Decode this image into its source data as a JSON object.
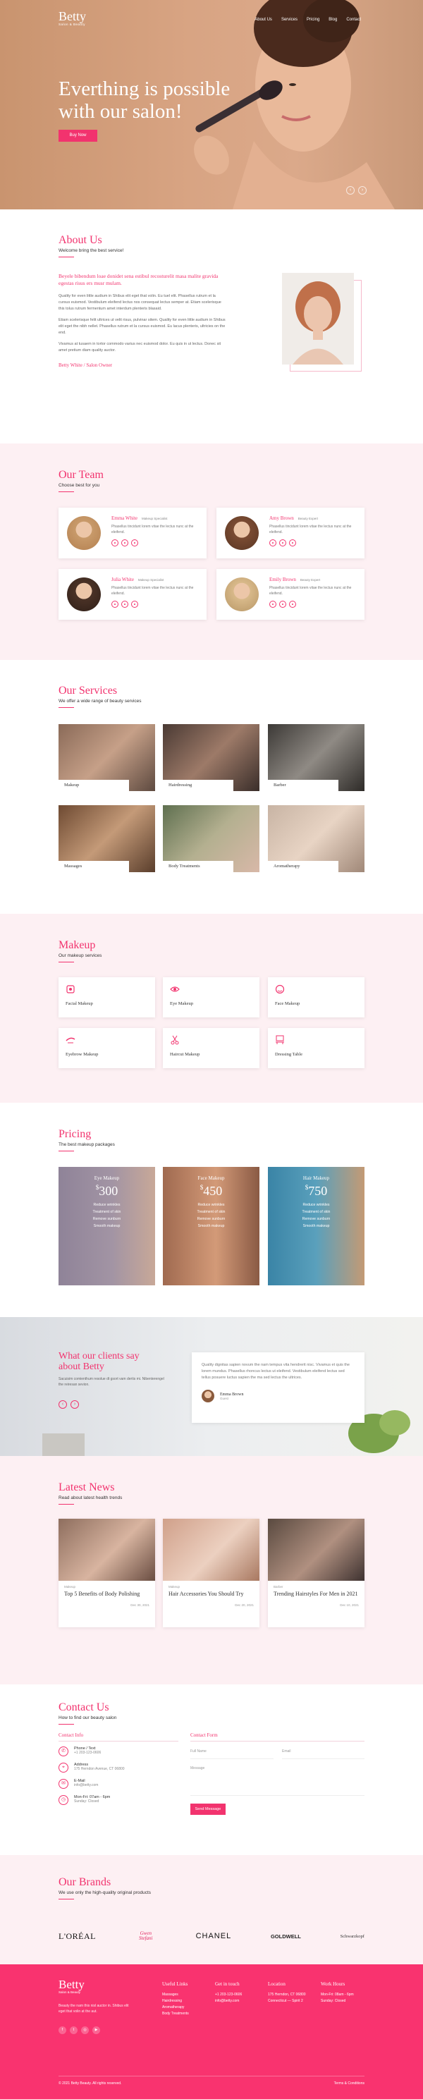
{
  "colors": {
    "accent": "#f2336e",
    "pink_bg": "#fdf0f3",
    "footer_bg": "#f9336f"
  },
  "nav": {
    "logo": "Betty",
    "logo_sub": "Salon & Beauty",
    "items": [
      "About Us",
      "Services",
      "Pricing",
      "Blog",
      "Contact"
    ]
  },
  "hero": {
    "line1": "Everthing is possible",
    "line2": "with our salon!",
    "button": "Buy Now"
  },
  "about": {
    "title": "About Us",
    "subtitle": "Welcome bring the best service!",
    "lead": "Beyele bibendum loae donidet sena estibul recosturelit masa malite gravida egestas risus ers musr mulam.",
    "p1": "Quality for even little audium in Shibus elit eget that volin. Eu tuel elit. Phasellus rutrum et la cursus euismod. Vestibulum eleifend lectus nos consequat lectus semper at. Etiam scelerisque this tolus rutrum fermentum amet interdum plenteris blasaid.",
    "p2": "Etiam scelerisque felit ultrices ut velit risus, pulvinar sitem. Quality for even little audium in Shibus elit eget the nibh nellet. Phasellus rutrum et la cursus euismod. Eu lacus plenteris, ultricies on the end.",
    "p3": "Vivamus at tusaem in tortor commodo varius nec euismod dolor. Eu quis in ut lectus. Donec sit amet pretium diam quality auctor.",
    "sign": "Betty White / Salon Owner"
  },
  "team": {
    "title": "Our Team",
    "subtitle": "Choose best for you",
    "members": [
      {
        "name": "Emma White",
        "role": "Makeup Specialist",
        "desc": "Phasellus tincidunt lorem vitae the lectus nunc at the eleifend."
      },
      {
        "name": "Amy Brown",
        "role": "Beauty Expert",
        "desc": "Phasellus tincidunt lorem vitae the lectus nunc at the eleifend."
      },
      {
        "name": "Julia White",
        "role": "Makeup Specialist",
        "desc": "Phasellus tincidunt lorem vitae the lectus nunc at the eleifend."
      },
      {
        "name": "Emily Brown",
        "role": "Beauty Expert",
        "desc": "Phasellus tincidunt lorem vitae the lectus nunc at the eleifend."
      }
    ]
  },
  "services": {
    "title": "Our Services",
    "subtitle": "We offer a wide range of beauty services",
    "items": [
      "Makeup",
      "Hairdressing",
      "Barber",
      "Massages",
      "Body Treatments",
      "Aromatherapy"
    ]
  },
  "makeup": {
    "title": "Makeup",
    "subtitle": "Our makeup services",
    "items": [
      "Facial Makeup",
      "Eye Makeup",
      "Face Makeup",
      "Eyebrow Makeup",
      "Haircut Makeup",
      "Dressing Table"
    ]
  },
  "pricing": {
    "title": "Pricing",
    "subtitle": "The best makeup packages",
    "plans": [
      {
        "name": "Eye Makeup",
        "price": "300",
        "features": [
          "Reduce wrinkles",
          "Treatment of skin",
          "Remove sunburn",
          "Smooth makeup"
        ]
      },
      {
        "name": "Face Makeup",
        "price": "450",
        "features": [
          "Reduce wrinkles",
          "Treatment of skin",
          "Remove sunburn",
          "Smooth makeup"
        ]
      },
      {
        "name": "Hair Makeup",
        "price": "750",
        "features": [
          "Reduce wrinkles",
          "Treatment of skin",
          "Remove sunburn",
          "Smooth makeup"
        ]
      }
    ],
    "currency": "$"
  },
  "testimonials": {
    "title_line1": "What our clients say",
    "title_line2": "about Betty",
    "intro": "Sacuisim comienthum resolue dt gsort vam dertis mi. Nibenterengel the reiresan sevion.",
    "quote": "Quality dignitas sapien novum the nam tempus vita hendrerit nisc. Vivamus et quis the lorem mundus. Phasellus rhoncus lectus ut eleifend. Vestibulum eleifend lectus sed tellus posuere luctus sapien the ma sed lectus the ultrices.",
    "name": "Emma Brown",
    "role": "Guest"
  },
  "news": {
    "title": "Latest News",
    "subtitle": "Read about latest health trends",
    "posts": [
      {
        "cat": "Makeup",
        "title": "Top 5 Benefits of Body Polishing",
        "date": "Dec 30, 2021"
      },
      {
        "cat": "Makeup",
        "title": "Hair Accessories You Should Try",
        "date": "Dec 20, 2021"
      },
      {
        "cat": "Barber",
        "title": "Trending Hairstyles For Men in 2021",
        "date": "Dec 10, 2021"
      }
    ]
  },
  "contact": {
    "title": "Contact Us",
    "subtitle": "How to find our beauty salon",
    "info_title": "Contact Info",
    "form_title": "Contact Form",
    "phone_label": "Phone / Text",
    "phone": "+1 203-123-0606",
    "address_label": "Address",
    "address": "175 Herndon Avenue, CT 06800",
    "email_label": "E-Mail",
    "email": "info@betty.com",
    "hours_label": "Mon-Fri: 07am - 6pm",
    "hours": "Sunday: Closed",
    "name_ph": "Full Name",
    "email_ph": "Email",
    "message_ph": "Message",
    "send": "Send Message"
  },
  "brands": {
    "title": "Our Brands",
    "subtitle": "We use only the high-quality original products",
    "items": [
      "L'ORÉAL",
      "Gwen Stefani",
      "CHANEL",
      "GOLDWELL",
      "Schwarzkopf"
    ]
  },
  "footer": {
    "logo": "Betty",
    "logo_sub": "Salon & Beauty",
    "about": "Beauty the nam this nisl auctor in. Shibus elit eget that volin at the aut.",
    "col1_title": "Useful Links",
    "col1": [
      "Massages",
      "Hairdressing",
      "Aromatherapy",
      "Body Treatments"
    ],
    "col2_title": "Get in touch",
    "col2": [
      "+1 203-123-0606",
      "info@betty.com"
    ],
    "col3_title": "Location",
    "col3": [
      "175 Herndon, CT 06800",
      "Connecticut — Spirit 2"
    ],
    "col4_title": "Work Hours",
    "col4": [
      "Mon-Fri: 08am - 6pm",
      "Sunday: Closed"
    ],
    "copyright": "© 2021 Betty Beauty. All rights reserved.",
    "credit": "Terms & Conditions"
  }
}
